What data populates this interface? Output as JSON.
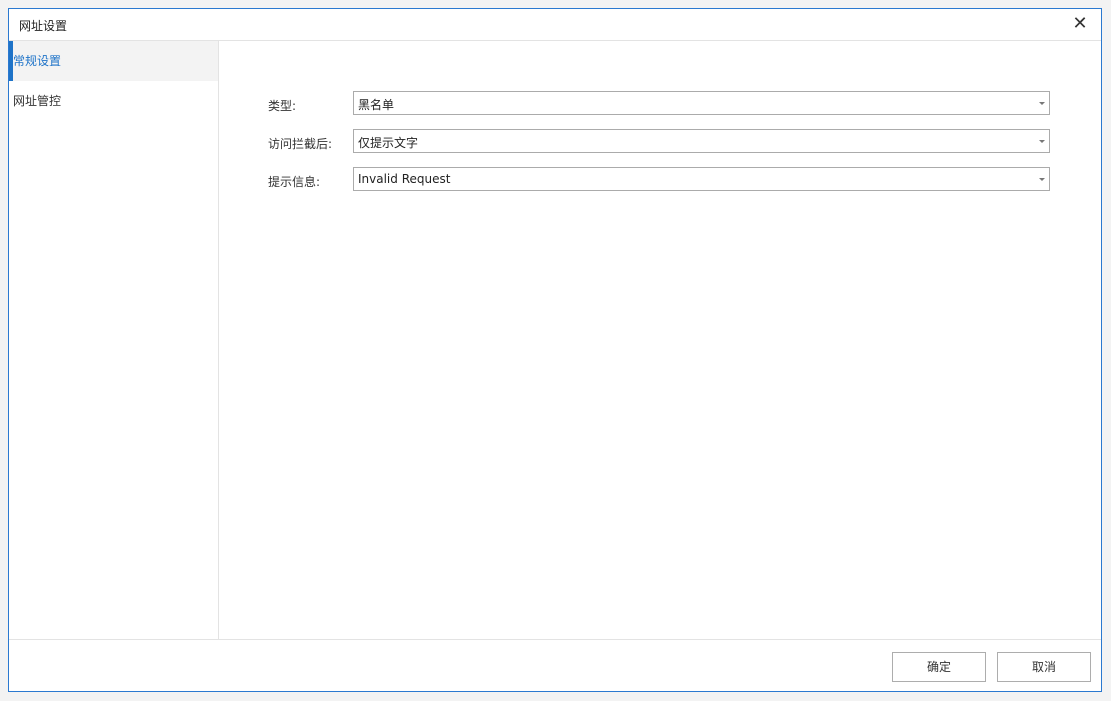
{
  "dialog": {
    "title": "网址设置",
    "close_icon": "close-icon"
  },
  "sidebar": {
    "items": [
      {
        "label": "常规设置",
        "active": true
      },
      {
        "label": "网址管控",
        "active": false
      }
    ]
  },
  "form": {
    "type": {
      "label": "类型:",
      "value": "黑名单"
    },
    "after_block": {
      "label": "访问拦截后:",
      "value": "仅提示文字"
    },
    "message": {
      "label": "提示信息:",
      "value": "Invalid Request"
    }
  },
  "footer": {
    "ok": "确定",
    "cancel": "取消"
  },
  "colors": {
    "accent": "#1e73c8",
    "border": "#2b79d0"
  }
}
